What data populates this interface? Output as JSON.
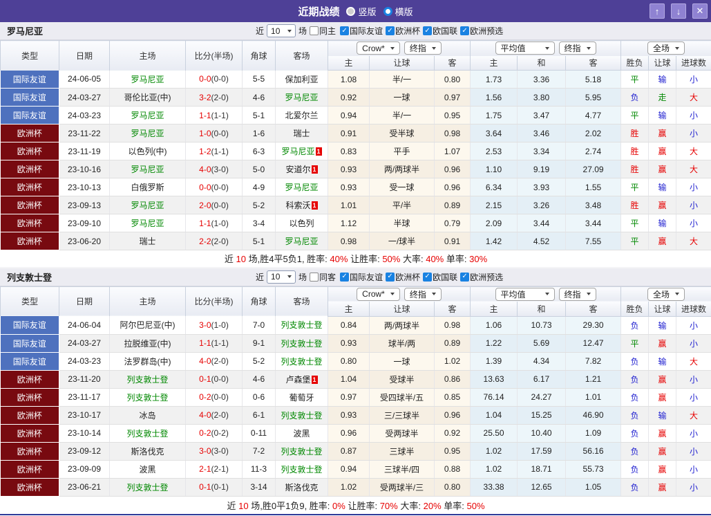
{
  "titlebar": {
    "title": "近期战绩",
    "radio_vertical": "竖版",
    "radio_horizontal": "横版"
  },
  "icons": {
    "up": "↑",
    "down": "↓",
    "close": "✕",
    "check": "✓"
  },
  "filters": {
    "near": "近",
    "unit": "场"
  },
  "header": {
    "type": "类型",
    "date": "日期",
    "home": "主场",
    "score": "比分(半场)",
    "corner": "角球",
    "away": "客场",
    "book_select": "Crow*",
    "final_select1": "终指",
    "avg_select": "平均值",
    "final_select2": "终指",
    "scope_select": "全场",
    "sub_home": "主",
    "sub_hand": "让球",
    "sub_away": "客",
    "sub_avg_home": "主",
    "sub_avg_draw": "和",
    "sub_avg_away": "客",
    "sub_wdl": "胜负",
    "sub_hand_res": "让球",
    "sub_goals": "进球数"
  },
  "sections": [
    {
      "team": "罗马尼亚",
      "count": "10",
      "same_label": "同主",
      "comps": [
        {
          "label": "国际友谊"
        },
        {
          "label": "欧洲杯"
        },
        {
          "label": "欧国联"
        },
        {
          "label": "欧洲预选"
        }
      ],
      "rows": [
        {
          "comp": "国际友谊",
          "compc": "cf",
          "date": "24-06-05",
          "home": "罗马尼亚",
          "homec": "tg",
          "homerc": "",
          "score": "0-0",
          "half": "(0-0)",
          "corner": "5-5",
          "away": "保加利亚",
          "awayc": "",
          "awayrc": "",
          "oh": "1.08",
          "ohd": "半/一",
          "oa": "0.80",
          "ah": "1.73",
          "ad": "3.36",
          "aa": "5.18",
          "r1": "平",
          "r1c": "tg",
          "r2": "输",
          "r2c": "tb",
          "r3": "小",
          "r3c": "tb"
        },
        {
          "comp": "国际友谊",
          "compc": "cf",
          "date": "24-03-27",
          "home": "哥伦比亚(中)",
          "homec": "",
          "homerc": "",
          "score": "3-2",
          "half": "(2-0)",
          "corner": "4-6",
          "away": "罗马尼亚",
          "awayc": "tg",
          "awayrc": "",
          "oh": "0.92",
          "ohd": "一球",
          "oa": "0.97",
          "ah": "1.56",
          "ad": "3.80",
          "aa": "5.95",
          "r1": "负",
          "r1c": "tb",
          "r2": "走",
          "r2c": "tg",
          "r3": "大",
          "r3c": "tr"
        },
        {
          "comp": "国际友谊",
          "compc": "cf",
          "date": "24-03-23",
          "home": "罗马尼亚",
          "homec": "tg",
          "homerc": "",
          "score": "1-1",
          "half": "(1-1)",
          "corner": "5-1",
          "away": "北爱尔兰",
          "awayc": "",
          "awayrc": "",
          "oh": "0.94",
          "ohd": "半/一",
          "oa": "0.95",
          "ah": "1.75",
          "ad": "3.47",
          "aa": "4.77",
          "r1": "平",
          "r1c": "tg",
          "r2": "输",
          "r2c": "tb",
          "r3": "小",
          "r3c": "tb"
        },
        {
          "comp": "欧洲杯",
          "compc": "ce",
          "date": "23-11-22",
          "home": "罗马尼亚",
          "homec": "tg",
          "homerc": "",
          "score": "1-0",
          "half": "(0-0)",
          "corner": "1-6",
          "away": "瑞士",
          "awayc": "",
          "awayrc": "",
          "oh": "0.91",
          "ohd": "受半球",
          "oa": "0.98",
          "ah": "3.64",
          "ad": "3.46",
          "aa": "2.02",
          "r1": "胜",
          "r1c": "tr",
          "r2": "赢",
          "r2c": "tr",
          "r3": "小",
          "r3c": "tb"
        },
        {
          "comp": "欧洲杯",
          "compc": "ce",
          "date": "23-11-19",
          "home": "以色列(中)",
          "homec": "",
          "homerc": "",
          "score": "1-2",
          "half": "(1-1)",
          "corner": "6-3",
          "away": "罗马尼亚",
          "awayc": "tg",
          "awayrc": "1",
          "oh": "0.83",
          "ohd": "平手",
          "oa": "1.07",
          "ah": "2.53",
          "ad": "3.34",
          "aa": "2.74",
          "r1": "胜",
          "r1c": "tr",
          "r2": "赢",
          "r2c": "tr",
          "r3": "大",
          "r3c": "tr"
        },
        {
          "comp": "欧洲杯",
          "compc": "ce",
          "date": "23-10-16",
          "home": "罗马尼亚",
          "homec": "tg",
          "homerc": "",
          "score": "4-0",
          "half": "(3-0)",
          "corner": "5-0",
          "away": "安道尔",
          "awayc": "",
          "awayrc": "1",
          "oh": "0.93",
          "ohd": "两/两球半",
          "oa": "0.96",
          "ah": "1.10",
          "ad": "9.19",
          "aa": "27.09",
          "r1": "胜",
          "r1c": "tr",
          "r2": "赢",
          "r2c": "tr",
          "r3": "大",
          "r3c": "tr"
        },
        {
          "comp": "欧洲杯",
          "compc": "ce",
          "date": "23-10-13",
          "home": "白俄罗斯",
          "homec": "",
          "homerc": "",
          "score": "0-0",
          "half": "(0-0)",
          "corner": "4-9",
          "away": "罗马尼亚",
          "awayc": "tg",
          "awayrc": "",
          "oh": "0.93",
          "ohd": "受一球",
          "oa": "0.96",
          "ah": "6.34",
          "ad": "3.93",
          "aa": "1.55",
          "r1": "平",
          "r1c": "tg",
          "r2": "输",
          "r2c": "tb",
          "r3": "小",
          "r3c": "tb"
        },
        {
          "comp": "欧洲杯",
          "compc": "ce",
          "date": "23-09-13",
          "home": "罗马尼亚",
          "homec": "tg",
          "homerc": "",
          "score": "2-0",
          "half": "(0-0)",
          "corner": "5-2",
          "away": "科索沃",
          "awayc": "",
          "awayrc": "1",
          "oh": "1.01",
          "ohd": "平/半",
          "oa": "0.89",
          "ah": "2.15",
          "ad": "3.26",
          "aa": "3.48",
          "r1": "胜",
          "r1c": "tr",
          "r2": "赢",
          "r2c": "tr",
          "r3": "小",
          "r3c": "tb"
        },
        {
          "comp": "欧洲杯",
          "compc": "ce",
          "date": "23-09-10",
          "home": "罗马尼亚",
          "homec": "tg",
          "homerc": "",
          "score": "1-1",
          "half": "(1-0)",
          "corner": "3-4",
          "away": "以色列",
          "awayc": "",
          "awayrc": "",
          "oh": "1.12",
          "ohd": "半球",
          "oa": "0.79",
          "ah": "2.09",
          "ad": "3.44",
          "aa": "3.44",
          "r1": "平",
          "r1c": "tg",
          "r2": "输",
          "r2c": "tb",
          "r3": "小",
          "r3c": "tb"
        },
        {
          "comp": "欧洲杯",
          "compc": "ce",
          "date": "23-06-20",
          "home": "瑞士",
          "homec": "",
          "homerc": "",
          "score": "2-2",
          "half": "(2-0)",
          "corner": "5-1",
          "away": "罗马尼亚",
          "awayc": "tg",
          "awayrc": "",
          "oh": "0.98",
          "ohd": "一/球半",
          "oa": "0.91",
          "ah": "1.42",
          "ad": "4.52",
          "aa": "7.55",
          "r1": "平",
          "r1c": "tg",
          "r2": "赢",
          "r2c": "tr",
          "r3": "大",
          "r3c": "tr"
        }
      ],
      "summary": [
        {
          "t": "近",
          "c": "sk"
        },
        {
          "t": "10",
          "c": "sr"
        },
        {
          "t": "场,胜4平5负1, 胜率:",
          "c": "sk"
        },
        {
          "t": "40%",
          "c": "sr"
        },
        {
          "t": " 让胜率:",
          "c": "sk"
        },
        {
          "t": "50%",
          "c": "sr"
        },
        {
          "t": " 大率:",
          "c": "sk"
        },
        {
          "t": "40%",
          "c": "sr"
        },
        {
          "t": " 单率:",
          "c": "sk"
        },
        {
          "t": "30%",
          "c": "sr"
        }
      ]
    },
    {
      "team": "列支敦士登",
      "count": "10",
      "same_label": "同客",
      "comps": [
        {
          "label": "国际友谊"
        },
        {
          "label": "欧洲杯"
        },
        {
          "label": "欧国联"
        },
        {
          "label": "欧洲预选"
        }
      ],
      "rows": [
        {
          "comp": "国际友谊",
          "compc": "cf",
          "date": "24-06-04",
          "home": "阿尔巴尼亚(中)",
          "homec": "",
          "homerc": "",
          "score": "3-0",
          "half": "(1-0)",
          "corner": "7-0",
          "away": "列支敦士登",
          "awayc": "tg",
          "awayrc": "",
          "oh": "0.84",
          "ohd": "两/两球半",
          "oa": "0.98",
          "ah": "1.06",
          "ad": "10.73",
          "aa": "29.30",
          "r1": "负",
          "r1c": "tb",
          "r2": "输",
          "r2c": "tb",
          "r3": "小",
          "r3c": "tb"
        },
        {
          "comp": "国际友谊",
          "compc": "cf",
          "date": "24-03-27",
          "home": "拉脱维亚(中)",
          "homec": "",
          "homerc": "",
          "score": "1-1",
          "half": "(1-1)",
          "corner": "9-1",
          "away": "列支敦士登",
          "awayc": "tg",
          "awayrc": "",
          "oh": "0.93",
          "ohd": "球半/两",
          "oa": "0.89",
          "ah": "1.22",
          "ad": "5.69",
          "aa": "12.47",
          "r1": "平",
          "r1c": "tg",
          "r2": "赢",
          "r2c": "tr",
          "r3": "小",
          "r3c": "tb"
        },
        {
          "comp": "国际友谊",
          "compc": "cf",
          "date": "24-03-23",
          "home": "法罗群岛(中)",
          "homec": "",
          "homerc": "",
          "score": "4-0",
          "half": "(2-0)",
          "corner": "5-2",
          "away": "列支敦士登",
          "awayc": "tg",
          "awayrc": "",
          "oh": "0.80",
          "ohd": "一球",
          "oa": "1.02",
          "ah": "1.39",
          "ad": "4.34",
          "aa": "7.82",
          "r1": "负",
          "r1c": "tb",
          "r2": "输",
          "r2c": "tb",
          "r3": "大",
          "r3c": "tr"
        },
        {
          "comp": "欧洲杯",
          "compc": "ce",
          "date": "23-11-20",
          "home": "列支敦士登",
          "homec": "tg",
          "homerc": "",
          "score": "0-1",
          "half": "(0-0)",
          "corner": "4-6",
          "away": "卢森堡",
          "awayc": "",
          "awayrc": "1",
          "oh": "1.04",
          "ohd": "受球半",
          "oa": "0.86",
          "ah": "13.63",
          "ad": "6.17",
          "aa": "1.21",
          "r1": "负",
          "r1c": "tb",
          "r2": "赢",
          "r2c": "tr",
          "r3": "小",
          "r3c": "tb"
        },
        {
          "comp": "欧洲杯",
          "compc": "ce",
          "date": "23-11-17",
          "home": "列支敦士登",
          "homec": "tg",
          "homerc": "",
          "score": "0-2",
          "half": "(0-0)",
          "corner": "0-6",
          "away": "葡萄牙",
          "awayc": "",
          "awayrc": "",
          "oh": "0.97",
          "ohd": "受四球半/五",
          "oa": "0.85",
          "ah": "76.14",
          "ad": "24.27",
          "aa": "1.01",
          "r1": "负",
          "r1c": "tb",
          "r2": "赢",
          "r2c": "tr",
          "r3": "小",
          "r3c": "tb"
        },
        {
          "comp": "欧洲杯",
          "compc": "ce",
          "date": "23-10-17",
          "home": "冰岛",
          "homec": "",
          "homerc": "",
          "score": "4-0",
          "half": "(2-0)",
          "corner": "6-1",
          "away": "列支敦士登",
          "awayc": "tg",
          "awayrc": "",
          "oh": "0.93",
          "ohd": "三/三球半",
          "oa": "0.96",
          "ah": "1.04",
          "ad": "15.25",
          "aa": "46.90",
          "r1": "负",
          "r1c": "tb",
          "r2": "输",
          "r2c": "tb",
          "r3": "大",
          "r3c": "tr"
        },
        {
          "comp": "欧洲杯",
          "compc": "ce",
          "date": "23-10-14",
          "home": "列支敦士登",
          "homec": "tg",
          "homerc": "",
          "score": "0-2",
          "half": "(0-2)",
          "corner": "0-11",
          "away": "波黑",
          "awayc": "",
          "awayrc": "",
          "oh": "0.96",
          "ohd": "受两球半",
          "oa": "0.92",
          "ah": "25.50",
          "ad": "10.40",
          "aa": "1.09",
          "r1": "负",
          "r1c": "tb",
          "r2": "赢",
          "r2c": "tr",
          "r3": "小",
          "r3c": "tb"
        },
        {
          "comp": "欧洲杯",
          "compc": "ce",
          "date": "23-09-12",
          "home": "斯洛伐克",
          "homec": "",
          "homerc": "",
          "score": "3-0",
          "half": "(3-0)",
          "corner": "7-2",
          "away": "列支敦士登",
          "awayc": "tg",
          "awayrc": "",
          "oh": "0.87",
          "ohd": "三球半",
          "oa": "0.95",
          "ah": "1.02",
          "ad": "17.59",
          "aa": "56.16",
          "r1": "负",
          "r1c": "tb",
          "r2": "赢",
          "r2c": "tr",
          "r3": "小",
          "r3c": "tb"
        },
        {
          "comp": "欧洲杯",
          "compc": "ce",
          "date": "23-09-09",
          "home": "波黑",
          "homec": "",
          "homerc": "",
          "score": "2-1",
          "half": "(2-1)",
          "corner": "11-3",
          "away": "列支敦士登",
          "awayc": "tg",
          "awayrc": "",
          "oh": "0.94",
          "ohd": "三球半/四",
          "oa": "0.88",
          "ah": "1.02",
          "ad": "18.71",
          "aa": "55.73",
          "r1": "负",
          "r1c": "tb",
          "r2": "赢",
          "r2c": "tr",
          "r3": "小",
          "r3c": "tb"
        },
        {
          "comp": "欧洲杯",
          "compc": "ce",
          "date": "23-06-21",
          "home": "列支敦士登",
          "homec": "tg",
          "homerc": "",
          "score": "0-1",
          "half": "(0-1)",
          "corner": "3-14",
          "away": "斯洛伐克",
          "awayc": "",
          "awayrc": "",
          "oh": "1.02",
          "ohd": "受两球半/三",
          "oa": "0.80",
          "ah": "33.38",
          "ad": "12.65",
          "aa": "1.05",
          "r1": "负",
          "r1c": "tb",
          "r2": "赢",
          "r2c": "tr",
          "r3": "小",
          "r3c": "tb"
        }
      ],
      "summary": [
        {
          "t": "近",
          "c": "sk"
        },
        {
          "t": "10",
          "c": "sr"
        },
        {
          "t": "场,胜0平1负9, 胜率:",
          "c": "sk"
        },
        {
          "t": "0%",
          "c": "sr"
        },
        {
          "t": " 让胜率:",
          "c": "sk"
        },
        {
          "t": "70%",
          "c": "sr"
        },
        {
          "t": " 大率:",
          "c": "sk"
        },
        {
          "t": "20%",
          "c": "sr"
        },
        {
          "t": " 单率:",
          "c": "sk"
        },
        {
          "t": "50%",
          "c": "sr"
        }
      ]
    }
  ]
}
